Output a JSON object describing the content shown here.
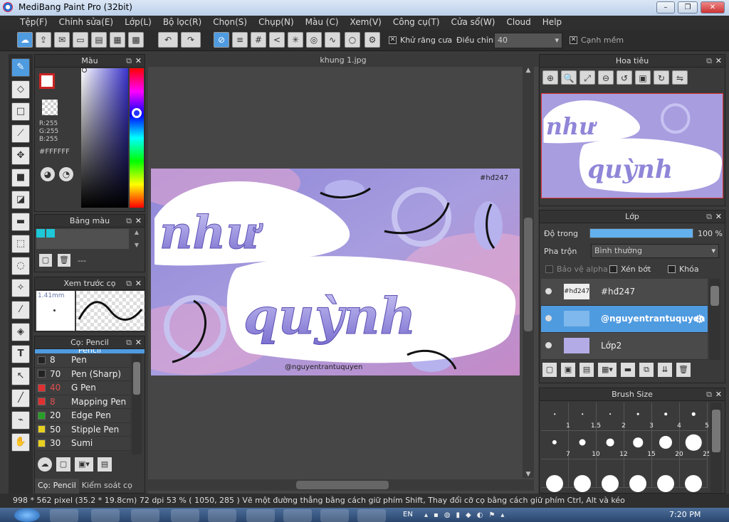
{
  "window": {
    "title": "MediBang Paint Pro (32bit)"
  },
  "menu": [
    "Tệp(F)",
    "Chỉnh sửa(E)",
    "Lớp(L)",
    "Bộ lọc(R)",
    "Chọn(S)",
    "Chụp(N)",
    "Màu (C)",
    "Xem(V)",
    "Công cụ(T)",
    "Cửa sổ(W)",
    "Cloud",
    "Help"
  ],
  "toolbar": {
    "antialias_label": "Khử răng cưa",
    "adjust_label": "Điều chỉnh",
    "adjust_value": "40",
    "smooth_label": "Cạnh mềm"
  },
  "color_panel": {
    "title": "Màu",
    "r": "R:255",
    "g": "G:255",
    "b": "B:255",
    "hex": "#FFFFFF"
  },
  "palette_panel": {
    "title": "Bảng màu",
    "swatch_name": "---"
  },
  "brush_preview": {
    "title": "Xem trước cọ",
    "size": "1.41mm"
  },
  "brush_panel": {
    "title": "Cọ: Pencil",
    "partial_top": "Pencil",
    "items": [
      {
        "size": "8",
        "name": "Pen",
        "color": "#222222"
      },
      {
        "size": "70",
        "name": "Pen (Sharp)",
        "color": "#222222"
      },
      {
        "size": "40",
        "name": "G Pen",
        "color": "#e03030"
      },
      {
        "size": "8",
        "name": "Mapping Pen",
        "color": "#e03030"
      },
      {
        "size": "20",
        "name": "Edge Pen",
        "color": "#28a028"
      },
      {
        "size": "50",
        "name": "Stipple Pen",
        "color": "#e8d020"
      },
      {
        "size": "30",
        "name": "Sumi",
        "color": "#e8d020"
      }
    ],
    "tab_brush": "Cọ: Pencil",
    "tab_control": "Kiểm soát cọ"
  },
  "canvas": {
    "tab": "khung 1.jpg",
    "tag_text": "#hđ247",
    "handle_text": "@nguyentrantuquyen"
  },
  "navigator": {
    "title": "Hoa tiêu"
  },
  "layer_panel": {
    "title": "Lớp",
    "opacity_label": "Độ trong",
    "opacity_value": "100 %",
    "opacity_fraction": 1.0,
    "blend_label": "Pha trộn",
    "blend_value": "Bình thường",
    "protect_alpha": "Bảo vệ alpha",
    "clip": "Xén bớt",
    "lock": "Khóa",
    "layers": [
      {
        "name": "#hđ247",
        "thumb": "#hđ247"
      },
      {
        "name": "@nguyentrantuquyen",
        "thumb": ""
      },
      {
        "name": "Lớp2",
        "thumb": ""
      }
    ]
  },
  "brush_size_panel": {
    "title": "Brush Size",
    "sizes": [
      "1",
      "1.5",
      "2",
      "3",
      "4",
      "5",
      "7",
      "10",
      "12",
      "15",
      "20",
      "25"
    ]
  },
  "status": {
    "text": "998 * 562 pixel   (35.2 * 19.8cm)   72 dpi   53 %   ( 1050, 285 )   Vẽ một đường thẳng bằng cách giữ phím Shift, Thay đổi cỡ cọ bằng cách giữ phím Ctrl, Alt và kéo"
  },
  "taskbar": {
    "time": "7:20 PM",
    "lang": "EN"
  }
}
